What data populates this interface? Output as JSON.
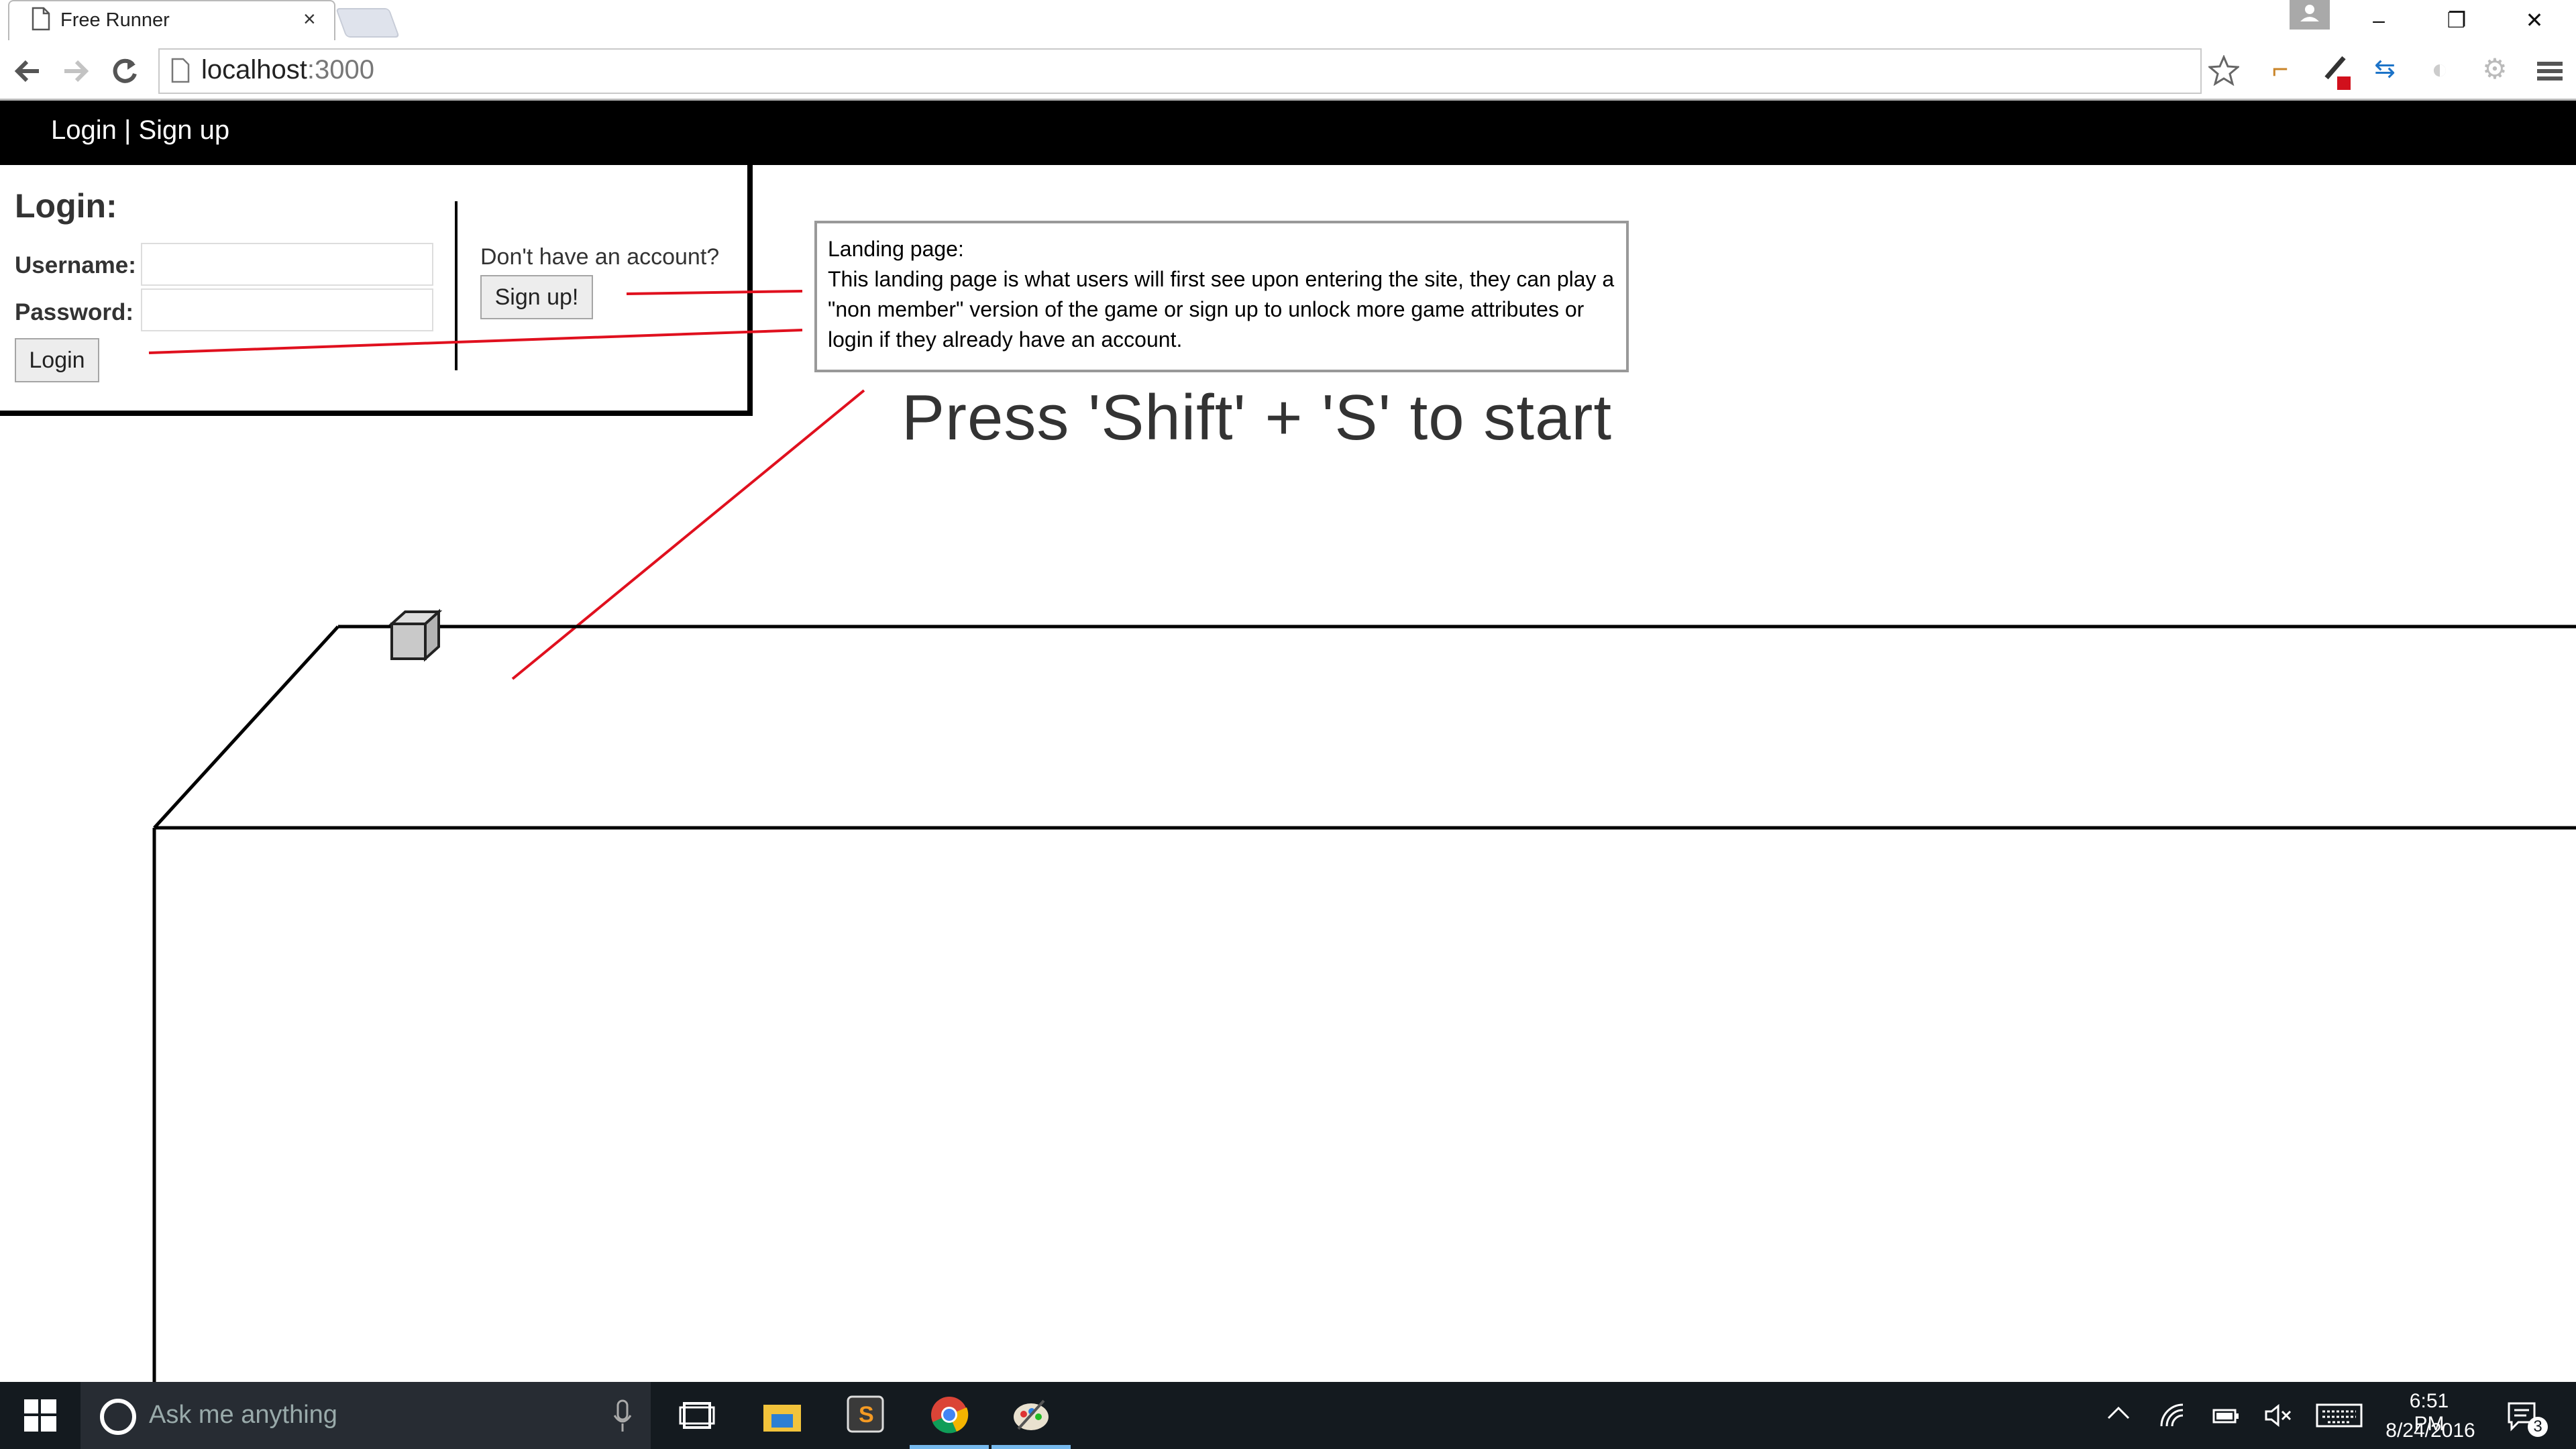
{
  "browser": {
    "tab_title": "Free Runner",
    "tab_close": "×",
    "url_host": "localhost",
    "url_port": ":3000",
    "window_controls": {
      "minimize": "–",
      "restore": "❐",
      "close": "✕"
    }
  },
  "nav": {
    "links_text": "Login | Sign up"
  },
  "login": {
    "heading": "Login:",
    "username_label": "Username:",
    "password_label": "Password:",
    "username_value": "",
    "password_value": "",
    "login_button": "Login",
    "no_account_text": "Don't have an account?",
    "signup_button": "Sign up!"
  },
  "annotation": {
    "line1": "Landing page:",
    "body": "This landing page is what users will first see upon entering the site, they can play a \"non member\" version of the game or sign up to unlock more game attributes or login if they already have an account."
  },
  "game": {
    "start_prompt": "Press 'Shift' + 'S' to start"
  },
  "taskbar": {
    "search_placeholder": "Ask me anything",
    "time": "6:51 PM",
    "date": "8/24/2016",
    "notification_count": "3"
  },
  "colors": {
    "annotation_line": "#e0101e",
    "nav_bg": "#000000",
    "taskbar_bg": "#141a1f"
  }
}
